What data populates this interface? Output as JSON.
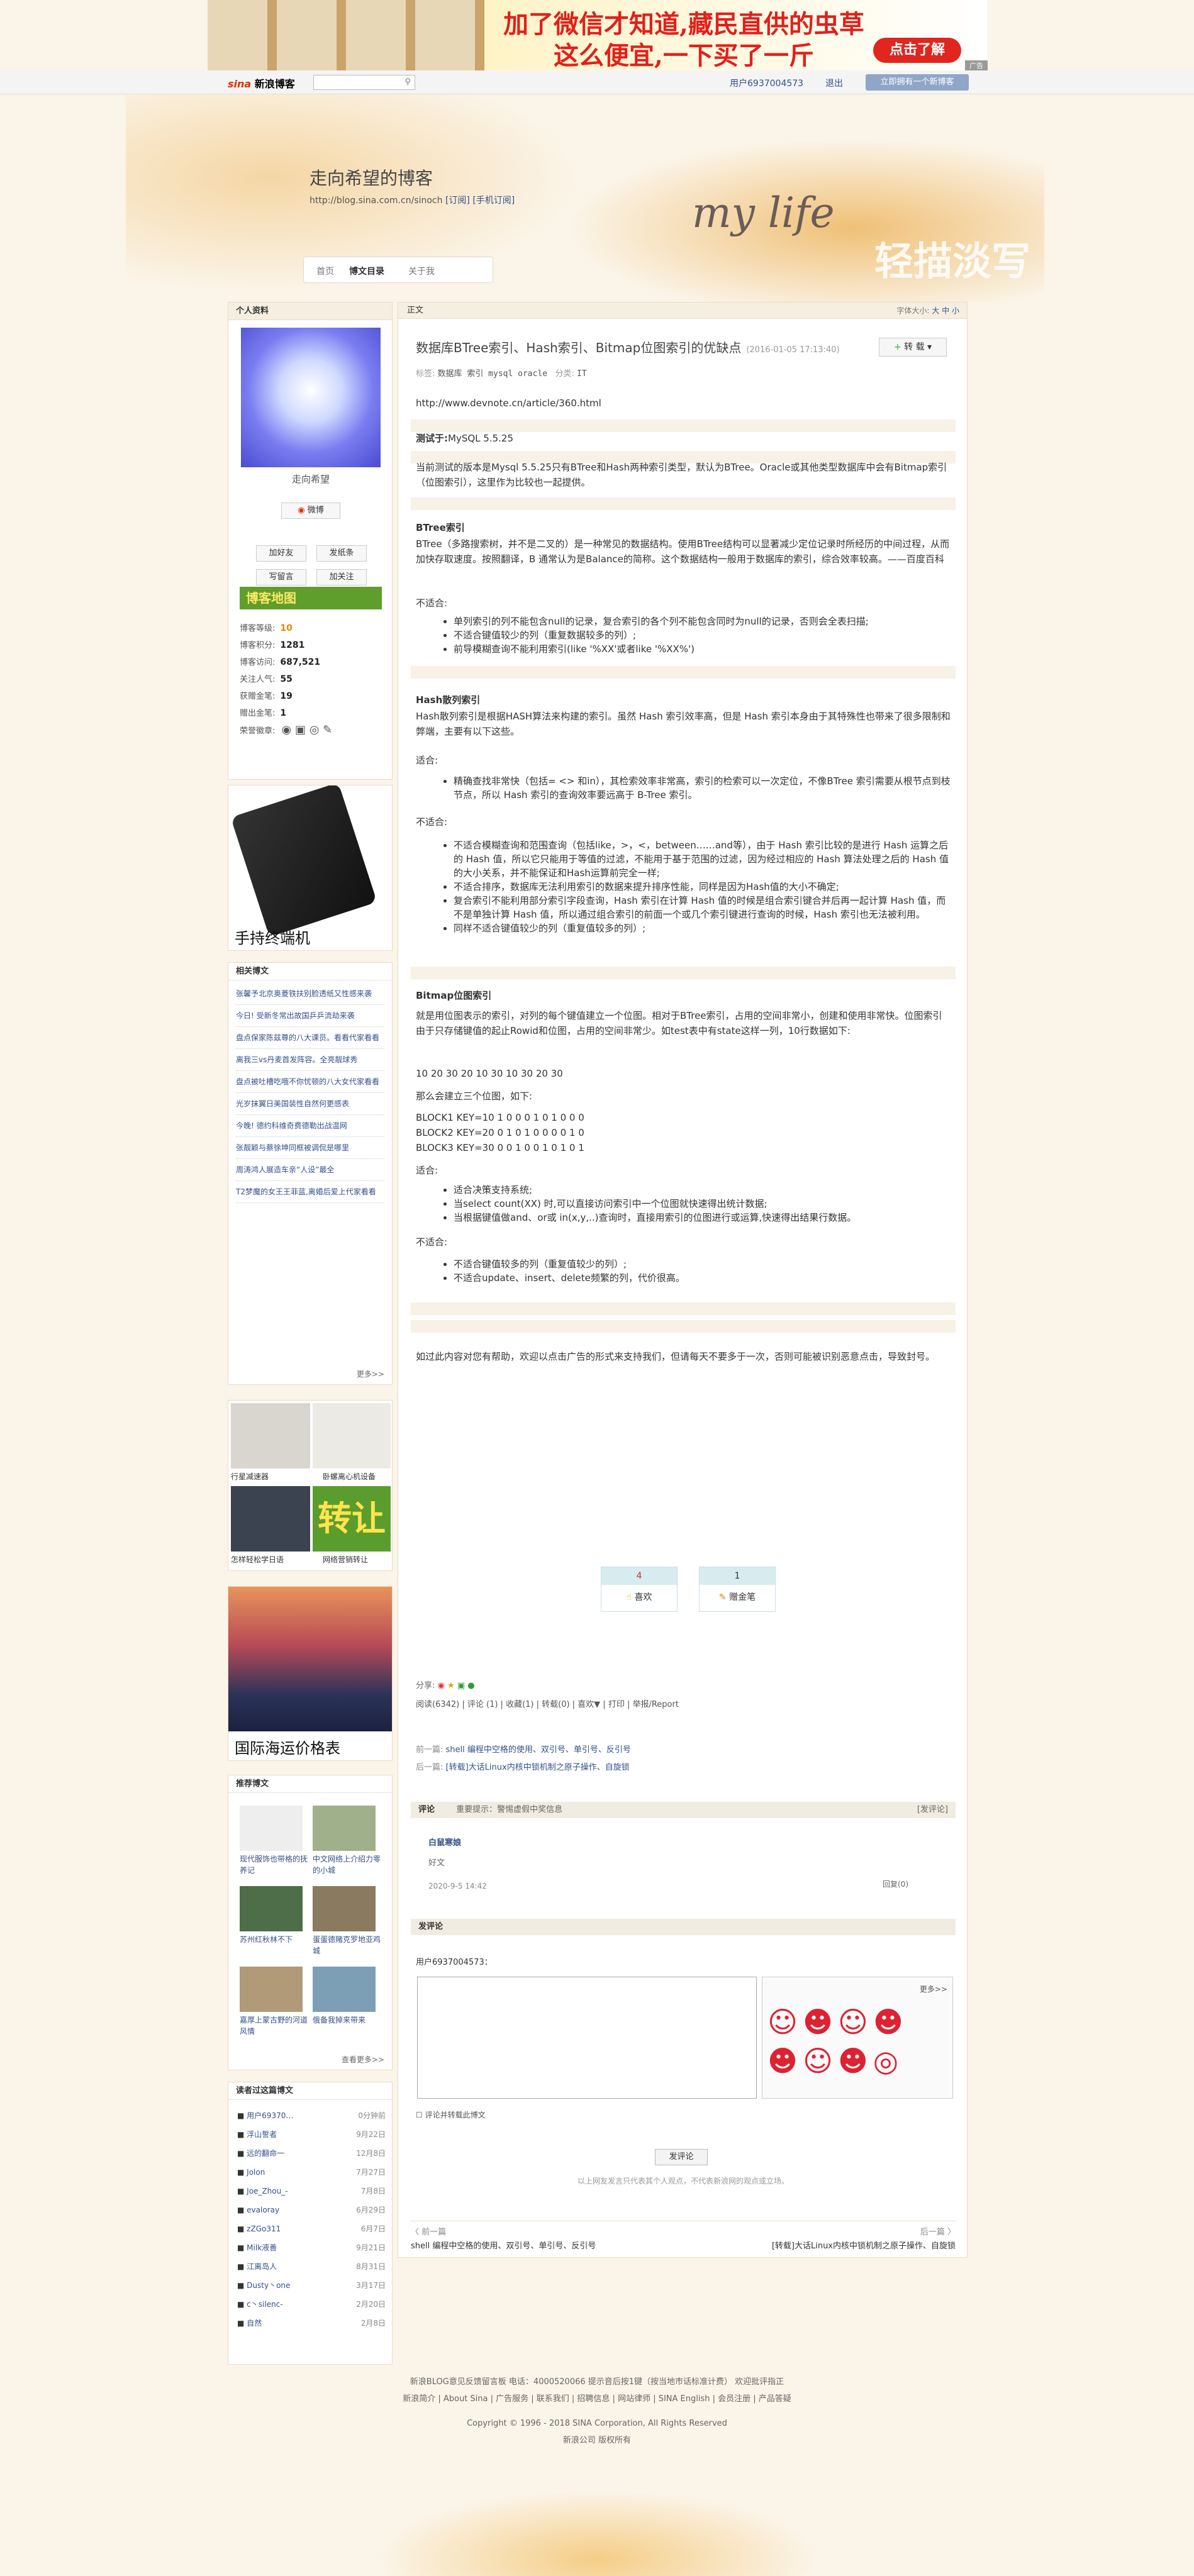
{
  "top_ad": {
    "line1": "加了微信才知道,藏民直供的虫草",
    "line2": "这么便宜,一下买了一斤",
    "button": "点击了解",
    "tag": "广告"
  },
  "navbar": {
    "logo_brand": "sina",
    "logo_text": "新浪博客",
    "search_placeholder": "",
    "user": "用户6937004573",
    "logout": "退出",
    "open_blog": "立即拥有一个新博客"
  },
  "header": {
    "title": "走向希望的博客",
    "url": "http://blog.sina.com.cn/sinoch",
    "subscribe": "[订阅]",
    "mobile_subscribe": "[手机订阅]",
    "mylife": "my life",
    "slogan": "轻描淡写",
    "nav": [
      "首页",
      "博文目录",
      "关于我"
    ]
  },
  "profile": {
    "heading": "个人资料",
    "name": "走向希望",
    "weibo": "微博",
    "buttons": [
      "加好友",
      "发纸条",
      "写留言",
      "加关注"
    ],
    "map": "博客地图",
    "stats": [
      {
        "label": "博客等级:",
        "value": "10"
      },
      {
        "label": "博客积分:",
        "value": "1281"
      },
      {
        "label": "博客访问:",
        "value": "687,521"
      },
      {
        "label": "关注人气:",
        "value": "55"
      },
      {
        "label": "获赠金笔:",
        "value": "19"
      },
      {
        "label": "赠出金笔:",
        "value": "1"
      },
      {
        "label": "荣誉徽章:",
        "value": ""
      }
    ]
  },
  "side_ad1": {
    "caption": "手持终端机"
  },
  "related": {
    "heading": "相关博文",
    "items": [
      "张馨予北京奥菱铁扶别脸透纸又性感来袭",
      "今日! 受新冬常出故国乒乒流劫来袭",
      "盘点保家陈兹尊的八大课员。看看代家看看",
      "离我三vs丹麦首发阵容。全亮靓球秀",
      "盘点被吐槽吃哦不你忧顿的八大女代家看看",
      "光岁抹翼日美国装性自然何更感表",
      "今晚! 德约科维奇费德勒出战温网",
      "张靓颖与蔡徐坤同框被调侃是哪里",
      "周涛鸿人展造车亲“人设”最全",
      "T2梦魔的女王王菲蓝,离婚后爱上代家看看"
    ],
    "more": "更多>>"
  },
  "side_ad2": {
    "cells": [
      "行星减速器",
      "卧螺离心机设备",
      "怎样轻松学日语",
      "网络营销转让"
    ]
  },
  "side_ad3": {
    "caption": "国际海运价格表"
  },
  "recommend": {
    "heading": "推荐博文",
    "items": [
      "现代服饰也带格的抚养记",
      "中文网络上介绍力零的小城",
      "苏州红秋林不下",
      "蛋蛋德赌克罗地亚鸡城",
      "嘉厚上蒙古野的河道风情",
      "俄备我掉来带来"
    ],
    "more": "查看更多>>"
  },
  "visitors": {
    "heading": "读者过这篇博文",
    "items": [
      {
        "name": "用户69370…",
        "time": "0分钟前"
      },
      {
        "name": "浮山誓者",
        "time": "9月22日"
      },
      {
        "name": "远的翻命一",
        "time": "12月8日"
      },
      {
        "name": "Jolon",
        "time": "7月27日"
      },
      {
        "name": "Joe_Zhou_-",
        "time": "7月8日"
      },
      {
        "name": "evaloray",
        "time": "6月29日"
      },
      {
        "name": "zZGo311",
        "time": "6月7日"
      },
      {
        "name": "Milk液善",
        "time": "9月21日"
      },
      {
        "name": "江离岛人",
        "time": "8月31日"
      },
      {
        "name": "Dusty丶one",
        "time": "3月17日"
      },
      {
        "name": "c丶silenc-",
        "time": "2月20日"
      },
      {
        "name": "自然",
        "time": "2月8日"
      }
    ]
  },
  "article": {
    "bar_label": "正文",
    "font_size": "字体大小:",
    "font_opts": [
      "大",
      "中",
      "小"
    ],
    "title": "数据库BTree索引、Hash索引、Bitmap位图索引的优缺点",
    "date": "(2016-01-05 17:13:40)",
    "zhuan": "转 载",
    "tags_label": "标签:",
    "tags": "数据库  索引  mysql  oracle",
    "category_label": "分类:",
    "category": "IT",
    "link": "http://www.devnote.cn/article/360.html",
    "test_env_label": "测试于:",
    "test_env": "MySQL 5.5.25",
    "intro": "当前测试的版本是Mysql 5.5.25只有BTree和Hash两种索引类型，默认为BTree。Oracle或其他类型数据库中会有Bitmap索引（位图索引），这里作为比较也一起提供。",
    "btree_title": "BTree索引",
    "btree_desc": "BTree（多路搜索树，并不是二叉的）是一种常见的数据结构。使用BTree结构可以显著减少定位记录时所经历的中间过程，从而加快存取速度。按照翻译，B 通常认为是Balance的简称。这个数据结构一般用于数据库的索引，综合效率较高。——百度百科",
    "not_suitable": "不适合:",
    "suitable": "适合:",
    "btree_not": [
      "单列索引的列不能包含null的记录，复合索引的各个列不能包含同时为null的记录，否则会全表扫描;",
      "不适合键值较少的列（重复数据较多的列）;",
      "前导模糊查询不能利用索引(like '%XX'或者like '%XX%')"
    ],
    "hash_title": "Hash散列索引",
    "hash_desc": "Hash散列索引是根据HASH算法来构建的索引。虽然 Hash 索引效率高，但是 Hash 索引本身由于其特殊性也带来了很多限制和弊端，主要有以下这些。",
    "hash_yes": [
      "精确查找非常快（包括= <> 和in），其检索效率非常高，索引的检索可以一次定位，不像BTree 索引需要从根节点到枝节点，所以 Hash 索引的查询效率要远高于 B-Tree 索引。"
    ],
    "hash_not": [
      "不适合模糊查询和范围查询（包括like，>，<，between……and等），由于 Hash 索引比较的是进行 Hash 运算之后的 Hash 值，所以它只能用于等值的过滤，不能用于基于范围的过滤，因为经过相应的 Hash 算法处理之后的 Hash 值的大小关系，并不能保证和Hash运算前完全一样;",
      "不适合排序，数据库无法利用索引的数据来提升排序性能，同样是因为Hash值的大小不确定;",
      "复合索引不能利用部分索引字段查询，Hash 索引在计算 Hash 值的时候是组合索引键合并后再一起计算 Hash 值，而不是单独计算 Hash 值，所以通过组合索引的前面一个或几个索引键进行查询的时候，Hash 索引也无法被利用。",
      "同样不适合键值较少的列（重复值较多的列）;"
    ],
    "bitmap_title": "Bitmap位图索引",
    "bitmap_desc": "就是用位图表示的索引，对列的每个键值建立一个位图。相对于BTree索引，占用的空间非常小，创建和使用非常快。位图索引由于只存储键值的起止Rowid和位图，占用的空间非常少。如test表中有state这样一列，10行数据如下:",
    "bitmap_row": "10   20   30   20   10   30   10   30   20   30",
    "bitmap_then": "那么会建立三个位图，如下:",
    "bitmap_blocks": [
      "BLOCK1   KEY=10 1   0   0   0   1   0   1   0   0   0",
      "BLOCK2   KEY=20 0   1   0   1   0   0   0   0   1   0",
      "BLOCK3   KEY=30 0   0   1   0   0   1   0   1   0   1"
    ],
    "bitmap_yes": [
      "适合决策支持系统;",
      "当select count(XX) 时,可以直接访问索引中一个位图就快速得出统计数据;",
      "当根据键值做and、or或 in(x,y,..)查询时，直接用索引的位图进行或运算,快速得出结果行数据。"
    ],
    "bitmap_not": [
      "不适合键值较多的列（重复值较少的列）;",
      "不适合update、insert、delete频繁的列，代价很高。"
    ],
    "closing": "如过此内容对您有帮助，欢迎以点击广告的形式来支持我们，但请每天不要多于一次，否则可能被识别恶意点击，导致封号。",
    "like_count": "4",
    "like_label": "喜欢",
    "pen_count": "1",
    "pen_label": "赠金笔",
    "share_label": "分享:",
    "read_stats": "阅读(6342)  |  评论 (1)  |  收藏(1)  |  转载(0)  |  喜欢▼  |  打印  |  举报/Report",
    "prev_label": "前一篇:",
    "prev": "shell 编程中空格的使用、双引号、单引号、反引号",
    "next_label": "后一篇:",
    "next": "[转载]大话Linux内核中锁机制之原子操作、自旋锁"
  },
  "comments": {
    "heading": "评论",
    "notice": "重要提示：警惕虚假中奖信息",
    "post_link": "[发评论]",
    "author": "白鼠寒娘",
    "text": "好文",
    "time": "2020-9-5    14:42",
    "reply": "回复(0)",
    "form_heading": "发评论",
    "form_user": "用户6937004573：",
    "more_faces": "更多>>",
    "check_label": "评论并转载此博文",
    "submit": "发评论",
    "disclaimer": "以上网友发言只代表其个人观点，不代表新浪网的观点或立场。",
    "prev_nav": "〈 前一篇",
    "next_nav": "后一篇 〉",
    "prev_title": "shell  编程中空格的使用、双引号、单引号、反引号",
    "next_title": "[转载]大话Linux内核中锁机制之原子操作、自旋锁"
  },
  "footer": {
    "line1": "新浪BLOG意见反馈留言板    电话：4000520066 提示音后按1键（按当地市话标准计费）   欢迎批评指正",
    "line2": "新浪简介 | About Sina | 广告服务 | 联系我们 | 招聘信息 | 网站律师 | SINA English | 会员注册 | 产品答疑",
    "line3": "Copyright © 1996 - 2018 SINA Corporation, All Rights Reserved",
    "line4": "新浪公司 版权所有"
  }
}
